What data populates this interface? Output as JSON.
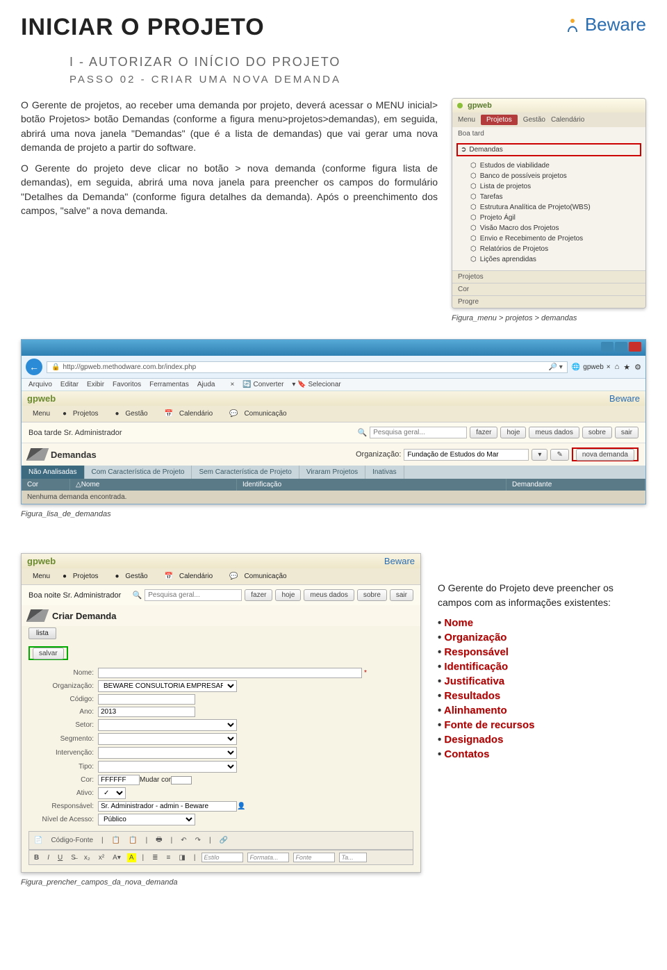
{
  "brand": {
    "name": "Beware"
  },
  "page_title": "INICIAR O PROJETO",
  "section": {
    "line1": "I - AUTORIZAR O INÍCIO DO PROJETO",
    "line2": "PASSO 02 - CRIAR UMA NOVA DEMANDA"
  },
  "body": {
    "p1": "O Gerente de projetos, ao receber uma demanda por projeto, deverá acessar o MENU inicial> botão Projetos> botão Demandas (conforme a figura menu>projetos>demandas), em seguida, abrirá uma nova janela \"Demandas\" (que é a lista de demandas) que vai gerar uma nova demanda de projeto a partir do software.",
    "p2": "O Gerente do projeto deve clicar no botão > nova demanda (conforme figura lista de demandas), em seguida, abrirá uma nova janela para preencher os campos do formulário \"Detalhes da Demanda\" (conforme figura detalhes da demanda). Após o preenchimento dos campos, \"salve\" a nova demanda."
  },
  "fig1": {
    "app": "gpweb",
    "tabs": {
      "menu": "Menu",
      "projetos": "Projetos",
      "gestao": "Gestão",
      "calendario": "Calendário"
    },
    "greet": "Boa tard",
    "highlight": "Demandas",
    "items": [
      "Estudos de viabilidade",
      "Banco de possíveis projetos",
      "Lista de projetos",
      "Tarefas",
      "Estrutura Analítica de Projeto(WBS)",
      "Projeto Ágil",
      "Visão Macro dos Projetos",
      "Envio e Recebimento de Projetos",
      "Relatórios de Projetos",
      "Lições aprendidas"
    ],
    "side": {
      "projetos": "Projetos",
      "cor": "Cor",
      "progre": "Progre"
    },
    "caption": "Figura_menu > projetos > demandas"
  },
  "fig2": {
    "url": "http://gpweb.methodware.com.br/index.php",
    "tab_label": "gpweb",
    "ie_menu": [
      "Arquivo",
      "Editar",
      "Exibir",
      "Favoritos",
      "Ferramentas",
      "Ajuda"
    ],
    "ie_extra": {
      "converter": "Converter",
      "selecionar": "Selecionar"
    },
    "app": "gpweb",
    "brand": "Beware",
    "main_tabs": {
      "menu": "Menu",
      "projetos": "Projetos",
      "gestao": "Gestão",
      "calendario": "Calendário",
      "comunicacao": "Comunicação"
    },
    "greet": "Boa tarde Sr. Administrador",
    "search_ph": "Pesquisa geral...",
    "buttons": {
      "fazer": "fazer",
      "hoje": "hoje",
      "meus": "meus dados",
      "sobre": "sobre",
      "sair": "sair"
    },
    "dem_title": "Demandas",
    "org_label": "Organização:",
    "org_value": "Fundação de Estudos do Mar",
    "nova": "nova demanda",
    "subtabs": [
      "Não Analisadas",
      "Com Característica de Projeto",
      "Sem Característica de Projeto",
      "Viraram Projetos",
      "Inativas"
    ],
    "cols": {
      "cor": "Cor",
      "nome": "△Nome",
      "ident": "Identificação",
      "dem": "Demandante"
    },
    "empty": "Nenhuma demanda encontrada.",
    "caption": "Figura_lisa_de_demandas"
  },
  "fig3": {
    "app": "gpweb",
    "brand": "Beware",
    "main_tabs": {
      "menu": "Menu",
      "projetos": "Projetos",
      "gestao": "Gestão",
      "calendario": "Calendário",
      "comunicacao": "Comunicação"
    },
    "greet": "Boa noite Sr. Administrador",
    "search_ph": "Pesquisa geral...",
    "buttons": {
      "fazer": "fazer",
      "hoje": "hoje",
      "meus": "meus dados",
      "sobre": "sobre",
      "sair": "sair"
    },
    "criar_title": "Criar Demanda",
    "lista": "lista",
    "salvar": "salvar",
    "form": {
      "nome_l": "Nome:",
      "nome_v": "",
      "org_l": "Organização:",
      "org_v": "BEWARE CONSULTORIA EMPRESARIAL LTDA",
      "cod_l": "Código:",
      "cod_v": "",
      "ano_l": "Ano:",
      "ano_v": "2013",
      "setor_l": "Setor:",
      "seg_l": "Segmento:",
      "int_l": "Intervenção:",
      "tipo_l": "Tipo:",
      "cor_l": "Cor:",
      "cor_v": "FFFFFF",
      "mudar": "Mudar cor",
      "ativo_l": "Ativo:",
      "resp_l": "Responsável:",
      "resp_v": "Sr. Administrador - admin - Beware",
      "nivel_l": "Nível de Acesso:",
      "nivel_v": "Público"
    },
    "rte": {
      "codigo": "Código-Fonte",
      "estilo": "Estilo",
      "formata": "Formata...",
      "fonte": "Fonte",
      "ta": "Ta..."
    },
    "caption": "Figura_prencher_campos_da_nova_demanda"
  },
  "right_panel": {
    "intro": "O Gerente do Projeto deve preencher os campos com as informações existentes:",
    "fields": [
      "Nome",
      "Organização",
      "Responsável",
      "Identificação",
      "Justificativa",
      "Resultados",
      "Alinhamento",
      "Fonte de recursos",
      "Designados",
      "Contatos"
    ]
  }
}
